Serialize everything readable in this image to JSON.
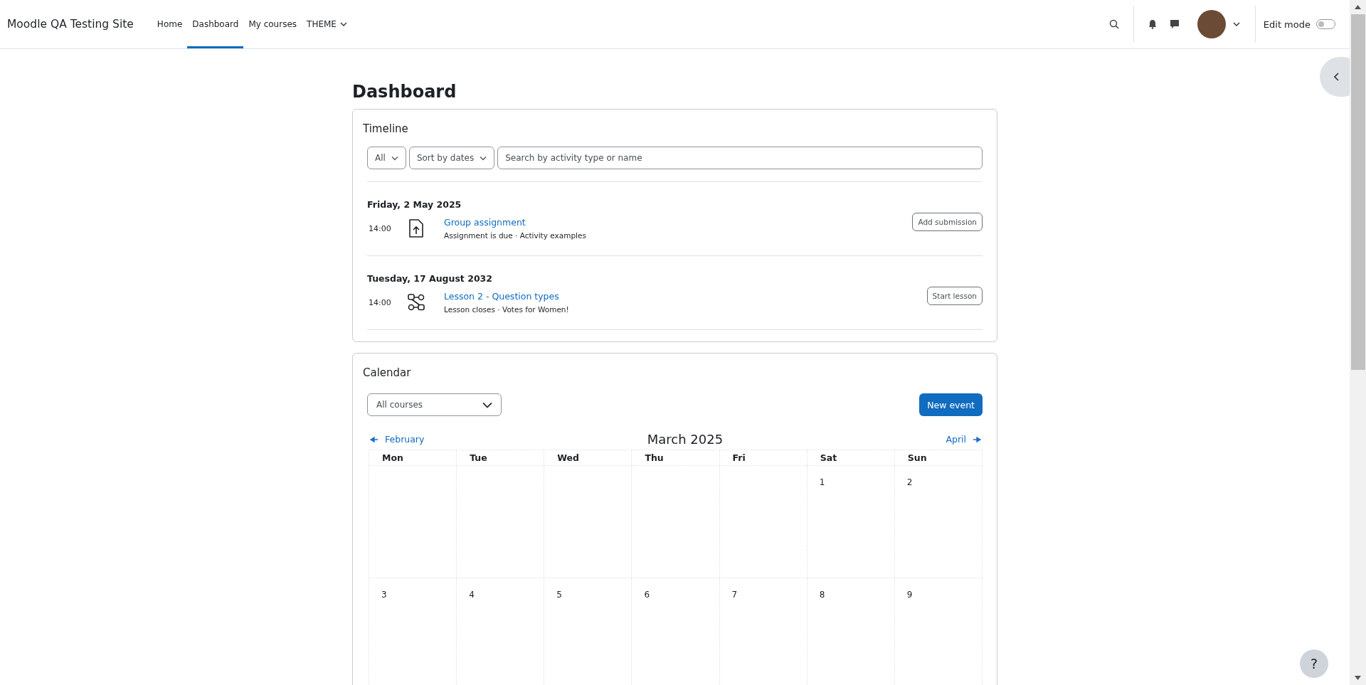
{
  "navbar": {
    "site_name": "Moodle QA Testing Site",
    "links": [
      {
        "label": "Home",
        "selected": false,
        "dropdown": false
      },
      {
        "label": "Dashboard",
        "selected": true,
        "dropdown": false
      },
      {
        "label": "My courses",
        "selected": false,
        "dropdown": false
      },
      {
        "label": "THEME",
        "selected": false,
        "dropdown": true
      }
    ],
    "edit_mode": {
      "label": "Edit mode",
      "on": false
    }
  },
  "page_title": "Dashboard",
  "timeline": {
    "title": "Timeline",
    "filter": "All",
    "sort": "Sort by dates",
    "search": {
      "placeholder": "Search by activity type or name"
    },
    "groups": [
      {
        "date": "Friday, 2 May 2025",
        "events": [
          {
            "time": "14:00",
            "kind": "assignment",
            "name": "Group assignment",
            "details": "Assignment is due · Activity examples",
            "action": "Add submission"
          }
        ]
      },
      {
        "date": "Tuesday, 17 August 2032",
        "events": [
          {
            "time": "14:00",
            "kind": "lesson",
            "name": "Lesson 2 - Question types",
            "details": "Lesson closes · Votes for Women!",
            "action": "Start lesson"
          }
        ]
      }
    ]
  },
  "calendar": {
    "title": "Calendar",
    "course_filter": "All courses",
    "new_event": "New event",
    "prev_month": "February",
    "month": "March 2025",
    "next_month": "April",
    "weekdays": [
      "Mon",
      "Tue",
      "Wed",
      "Thu",
      "Fri",
      "Sat",
      "Sun"
    ],
    "weeks": [
      [
        {
          "kind": "empty"
        },
        {
          "kind": "empty"
        },
        {
          "kind": "empty"
        },
        {
          "kind": "empty"
        },
        {
          "kind": "empty"
        },
        {
          "kind": "day",
          "day": "1"
        },
        {
          "kind": "day",
          "day": "2"
        }
      ],
      [
        {
          "kind": "day",
          "day": "3"
        },
        {
          "kind": "day",
          "day": "4"
        },
        {
          "kind": "day",
          "day": "5"
        },
        {
          "kind": "day",
          "day": "6"
        },
        {
          "kind": "day",
          "day": "7"
        },
        {
          "kind": "day",
          "day": "8"
        },
        {
          "kind": "day",
          "day": "9"
        }
      ]
    ]
  },
  "help": "?"
}
